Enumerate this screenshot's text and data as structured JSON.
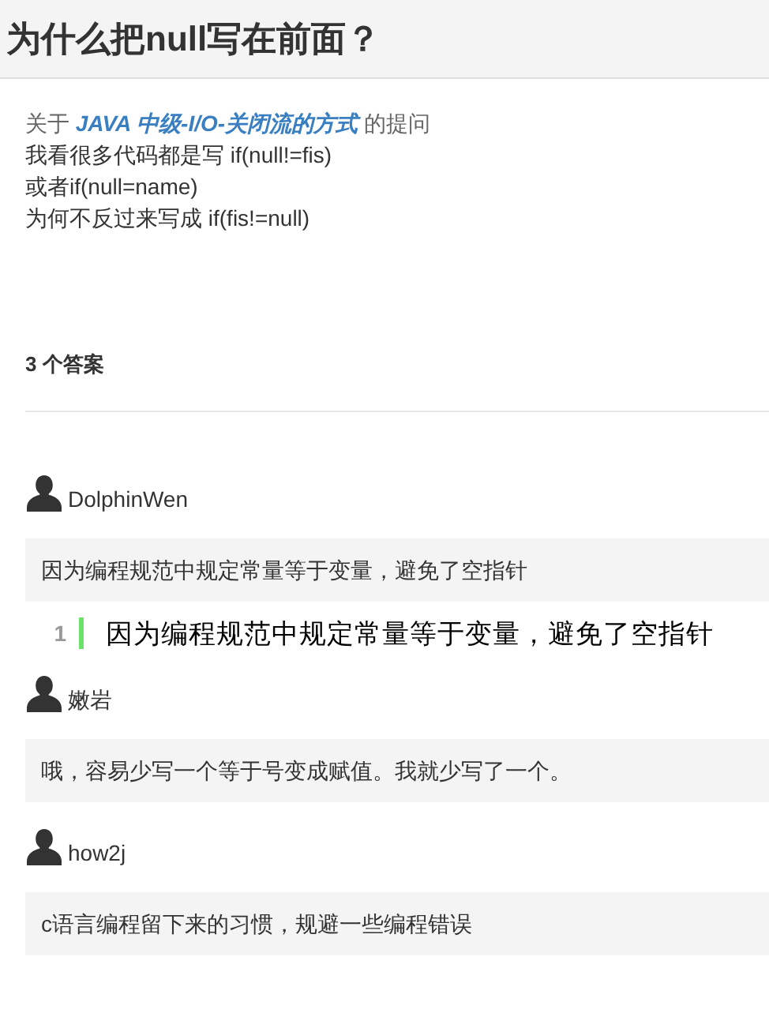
{
  "title": "为什么把null写在前面？",
  "question": {
    "prefix": "关于",
    "course_link": "JAVA 中级-I/O-关闭流的方式",
    "suffix": "的提问",
    "lines": [
      "我看很多代码都是写 if(null!=fis)",
      "或者if(null=name)",
      "为何不反过来写成 if(fis!=null)"
    ]
  },
  "answers_count": "3 个答案",
  "answers": [
    {
      "user": "DolphinWen",
      "text": "因为编程规范中规定常量等于变量，避免了空指针",
      "code_lines": [
        {
          "number": "1",
          "text": "因为编程规范中规定常量等于变量，避免了空指针"
        }
      ]
    },
    {
      "user": "嫩岩",
      "text": "哦，容易少写一个等于号变成赋值。我就少写了一个。"
    },
    {
      "user": "how2j",
      "text": "c语言编程留下来的习惯，规避一些编程错误"
    }
  ]
}
